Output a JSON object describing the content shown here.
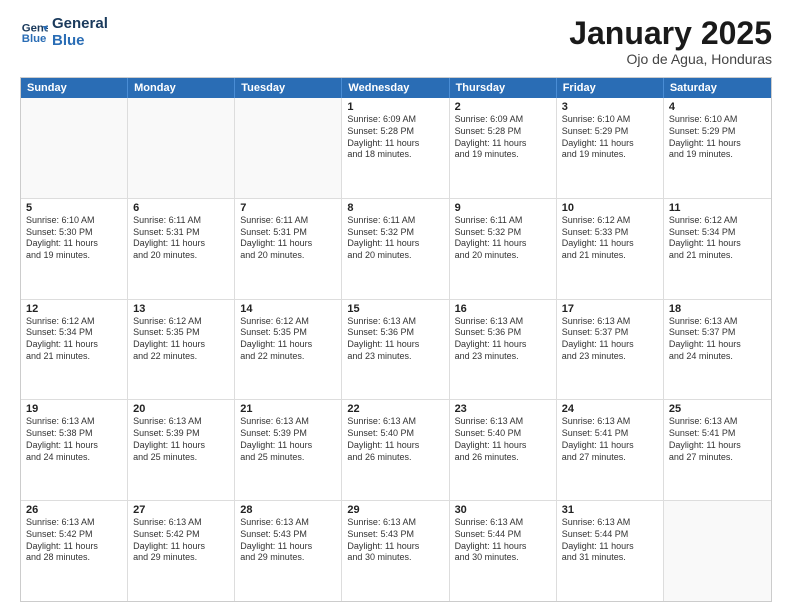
{
  "header": {
    "logo_line1": "General",
    "logo_line2": "Blue",
    "month_title": "January 2025",
    "location": "Ojo de Agua, Honduras"
  },
  "day_headers": [
    "Sunday",
    "Monday",
    "Tuesday",
    "Wednesday",
    "Thursday",
    "Friday",
    "Saturday"
  ],
  "weeks": [
    [
      {
        "num": "",
        "info": ""
      },
      {
        "num": "",
        "info": ""
      },
      {
        "num": "",
        "info": ""
      },
      {
        "num": "1",
        "info": "Sunrise: 6:09 AM\nSunset: 5:28 PM\nDaylight: 11 hours\nand 18 minutes."
      },
      {
        "num": "2",
        "info": "Sunrise: 6:09 AM\nSunset: 5:28 PM\nDaylight: 11 hours\nand 19 minutes."
      },
      {
        "num": "3",
        "info": "Sunrise: 6:10 AM\nSunset: 5:29 PM\nDaylight: 11 hours\nand 19 minutes."
      },
      {
        "num": "4",
        "info": "Sunrise: 6:10 AM\nSunset: 5:29 PM\nDaylight: 11 hours\nand 19 minutes."
      }
    ],
    [
      {
        "num": "5",
        "info": "Sunrise: 6:10 AM\nSunset: 5:30 PM\nDaylight: 11 hours\nand 19 minutes."
      },
      {
        "num": "6",
        "info": "Sunrise: 6:11 AM\nSunset: 5:31 PM\nDaylight: 11 hours\nand 20 minutes."
      },
      {
        "num": "7",
        "info": "Sunrise: 6:11 AM\nSunset: 5:31 PM\nDaylight: 11 hours\nand 20 minutes."
      },
      {
        "num": "8",
        "info": "Sunrise: 6:11 AM\nSunset: 5:32 PM\nDaylight: 11 hours\nand 20 minutes."
      },
      {
        "num": "9",
        "info": "Sunrise: 6:11 AM\nSunset: 5:32 PM\nDaylight: 11 hours\nand 20 minutes."
      },
      {
        "num": "10",
        "info": "Sunrise: 6:12 AM\nSunset: 5:33 PM\nDaylight: 11 hours\nand 21 minutes."
      },
      {
        "num": "11",
        "info": "Sunrise: 6:12 AM\nSunset: 5:34 PM\nDaylight: 11 hours\nand 21 minutes."
      }
    ],
    [
      {
        "num": "12",
        "info": "Sunrise: 6:12 AM\nSunset: 5:34 PM\nDaylight: 11 hours\nand 21 minutes."
      },
      {
        "num": "13",
        "info": "Sunrise: 6:12 AM\nSunset: 5:35 PM\nDaylight: 11 hours\nand 22 minutes."
      },
      {
        "num": "14",
        "info": "Sunrise: 6:12 AM\nSunset: 5:35 PM\nDaylight: 11 hours\nand 22 minutes."
      },
      {
        "num": "15",
        "info": "Sunrise: 6:13 AM\nSunset: 5:36 PM\nDaylight: 11 hours\nand 23 minutes."
      },
      {
        "num": "16",
        "info": "Sunrise: 6:13 AM\nSunset: 5:36 PM\nDaylight: 11 hours\nand 23 minutes."
      },
      {
        "num": "17",
        "info": "Sunrise: 6:13 AM\nSunset: 5:37 PM\nDaylight: 11 hours\nand 23 minutes."
      },
      {
        "num": "18",
        "info": "Sunrise: 6:13 AM\nSunset: 5:37 PM\nDaylight: 11 hours\nand 24 minutes."
      }
    ],
    [
      {
        "num": "19",
        "info": "Sunrise: 6:13 AM\nSunset: 5:38 PM\nDaylight: 11 hours\nand 24 minutes."
      },
      {
        "num": "20",
        "info": "Sunrise: 6:13 AM\nSunset: 5:39 PM\nDaylight: 11 hours\nand 25 minutes."
      },
      {
        "num": "21",
        "info": "Sunrise: 6:13 AM\nSunset: 5:39 PM\nDaylight: 11 hours\nand 25 minutes."
      },
      {
        "num": "22",
        "info": "Sunrise: 6:13 AM\nSunset: 5:40 PM\nDaylight: 11 hours\nand 26 minutes."
      },
      {
        "num": "23",
        "info": "Sunrise: 6:13 AM\nSunset: 5:40 PM\nDaylight: 11 hours\nand 26 minutes."
      },
      {
        "num": "24",
        "info": "Sunrise: 6:13 AM\nSunset: 5:41 PM\nDaylight: 11 hours\nand 27 minutes."
      },
      {
        "num": "25",
        "info": "Sunrise: 6:13 AM\nSunset: 5:41 PM\nDaylight: 11 hours\nand 27 minutes."
      }
    ],
    [
      {
        "num": "26",
        "info": "Sunrise: 6:13 AM\nSunset: 5:42 PM\nDaylight: 11 hours\nand 28 minutes."
      },
      {
        "num": "27",
        "info": "Sunrise: 6:13 AM\nSunset: 5:42 PM\nDaylight: 11 hours\nand 29 minutes."
      },
      {
        "num": "28",
        "info": "Sunrise: 6:13 AM\nSunset: 5:43 PM\nDaylight: 11 hours\nand 29 minutes."
      },
      {
        "num": "29",
        "info": "Sunrise: 6:13 AM\nSunset: 5:43 PM\nDaylight: 11 hours\nand 30 minutes."
      },
      {
        "num": "30",
        "info": "Sunrise: 6:13 AM\nSunset: 5:44 PM\nDaylight: 11 hours\nand 30 minutes."
      },
      {
        "num": "31",
        "info": "Sunrise: 6:13 AM\nSunset: 5:44 PM\nDaylight: 11 hours\nand 31 minutes."
      },
      {
        "num": "",
        "info": ""
      }
    ]
  ]
}
